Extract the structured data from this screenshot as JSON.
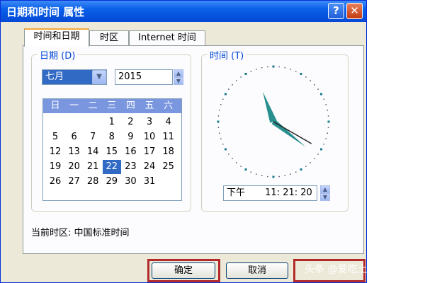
{
  "window": {
    "title": "日期和时间 属性",
    "help_glyph": "?",
    "close_glyph": "✕"
  },
  "tabs": [
    {
      "label": "时间和日期",
      "active": true
    },
    {
      "label": "时区",
      "active": false
    },
    {
      "label": "Internet 时间",
      "active": false
    }
  ],
  "date_group": {
    "label": "日期 (D)",
    "month": "七月",
    "year": "2015",
    "weekdays": [
      "日",
      "一",
      "二",
      "三",
      "四",
      "五",
      "六"
    ],
    "weeks": [
      [
        "",
        "",
        "",
        "1",
        "2",
        "3",
        "4"
      ],
      [
        "5",
        "6",
        "7",
        "8",
        "9",
        "10",
        "11"
      ],
      [
        "12",
        "13",
        "14",
        "15",
        "16",
        "17",
        "18"
      ],
      [
        "19",
        "20",
        "21",
        "22",
        "23",
        "24",
        "25"
      ],
      [
        "26",
        "27",
        "28",
        "29",
        "30",
        "31",
        ""
      ]
    ],
    "selected_day": "22"
  },
  "time_group": {
    "label": "时间 (T)",
    "ampm": "下午",
    "time": "11: 21: 20",
    "clock": {
      "hour": 11,
      "minute": 21,
      "second": 20
    }
  },
  "timezone_text": "当前时区: 中国标准时间",
  "buttons": {
    "ok": "确定",
    "cancel": "取消"
  },
  "watermark": "头条 @爱吃土豆炒山药",
  "colors": {
    "accent": "#316ac5",
    "highlight_box": "#b22a2a",
    "hands": "#2a8f8f"
  }
}
